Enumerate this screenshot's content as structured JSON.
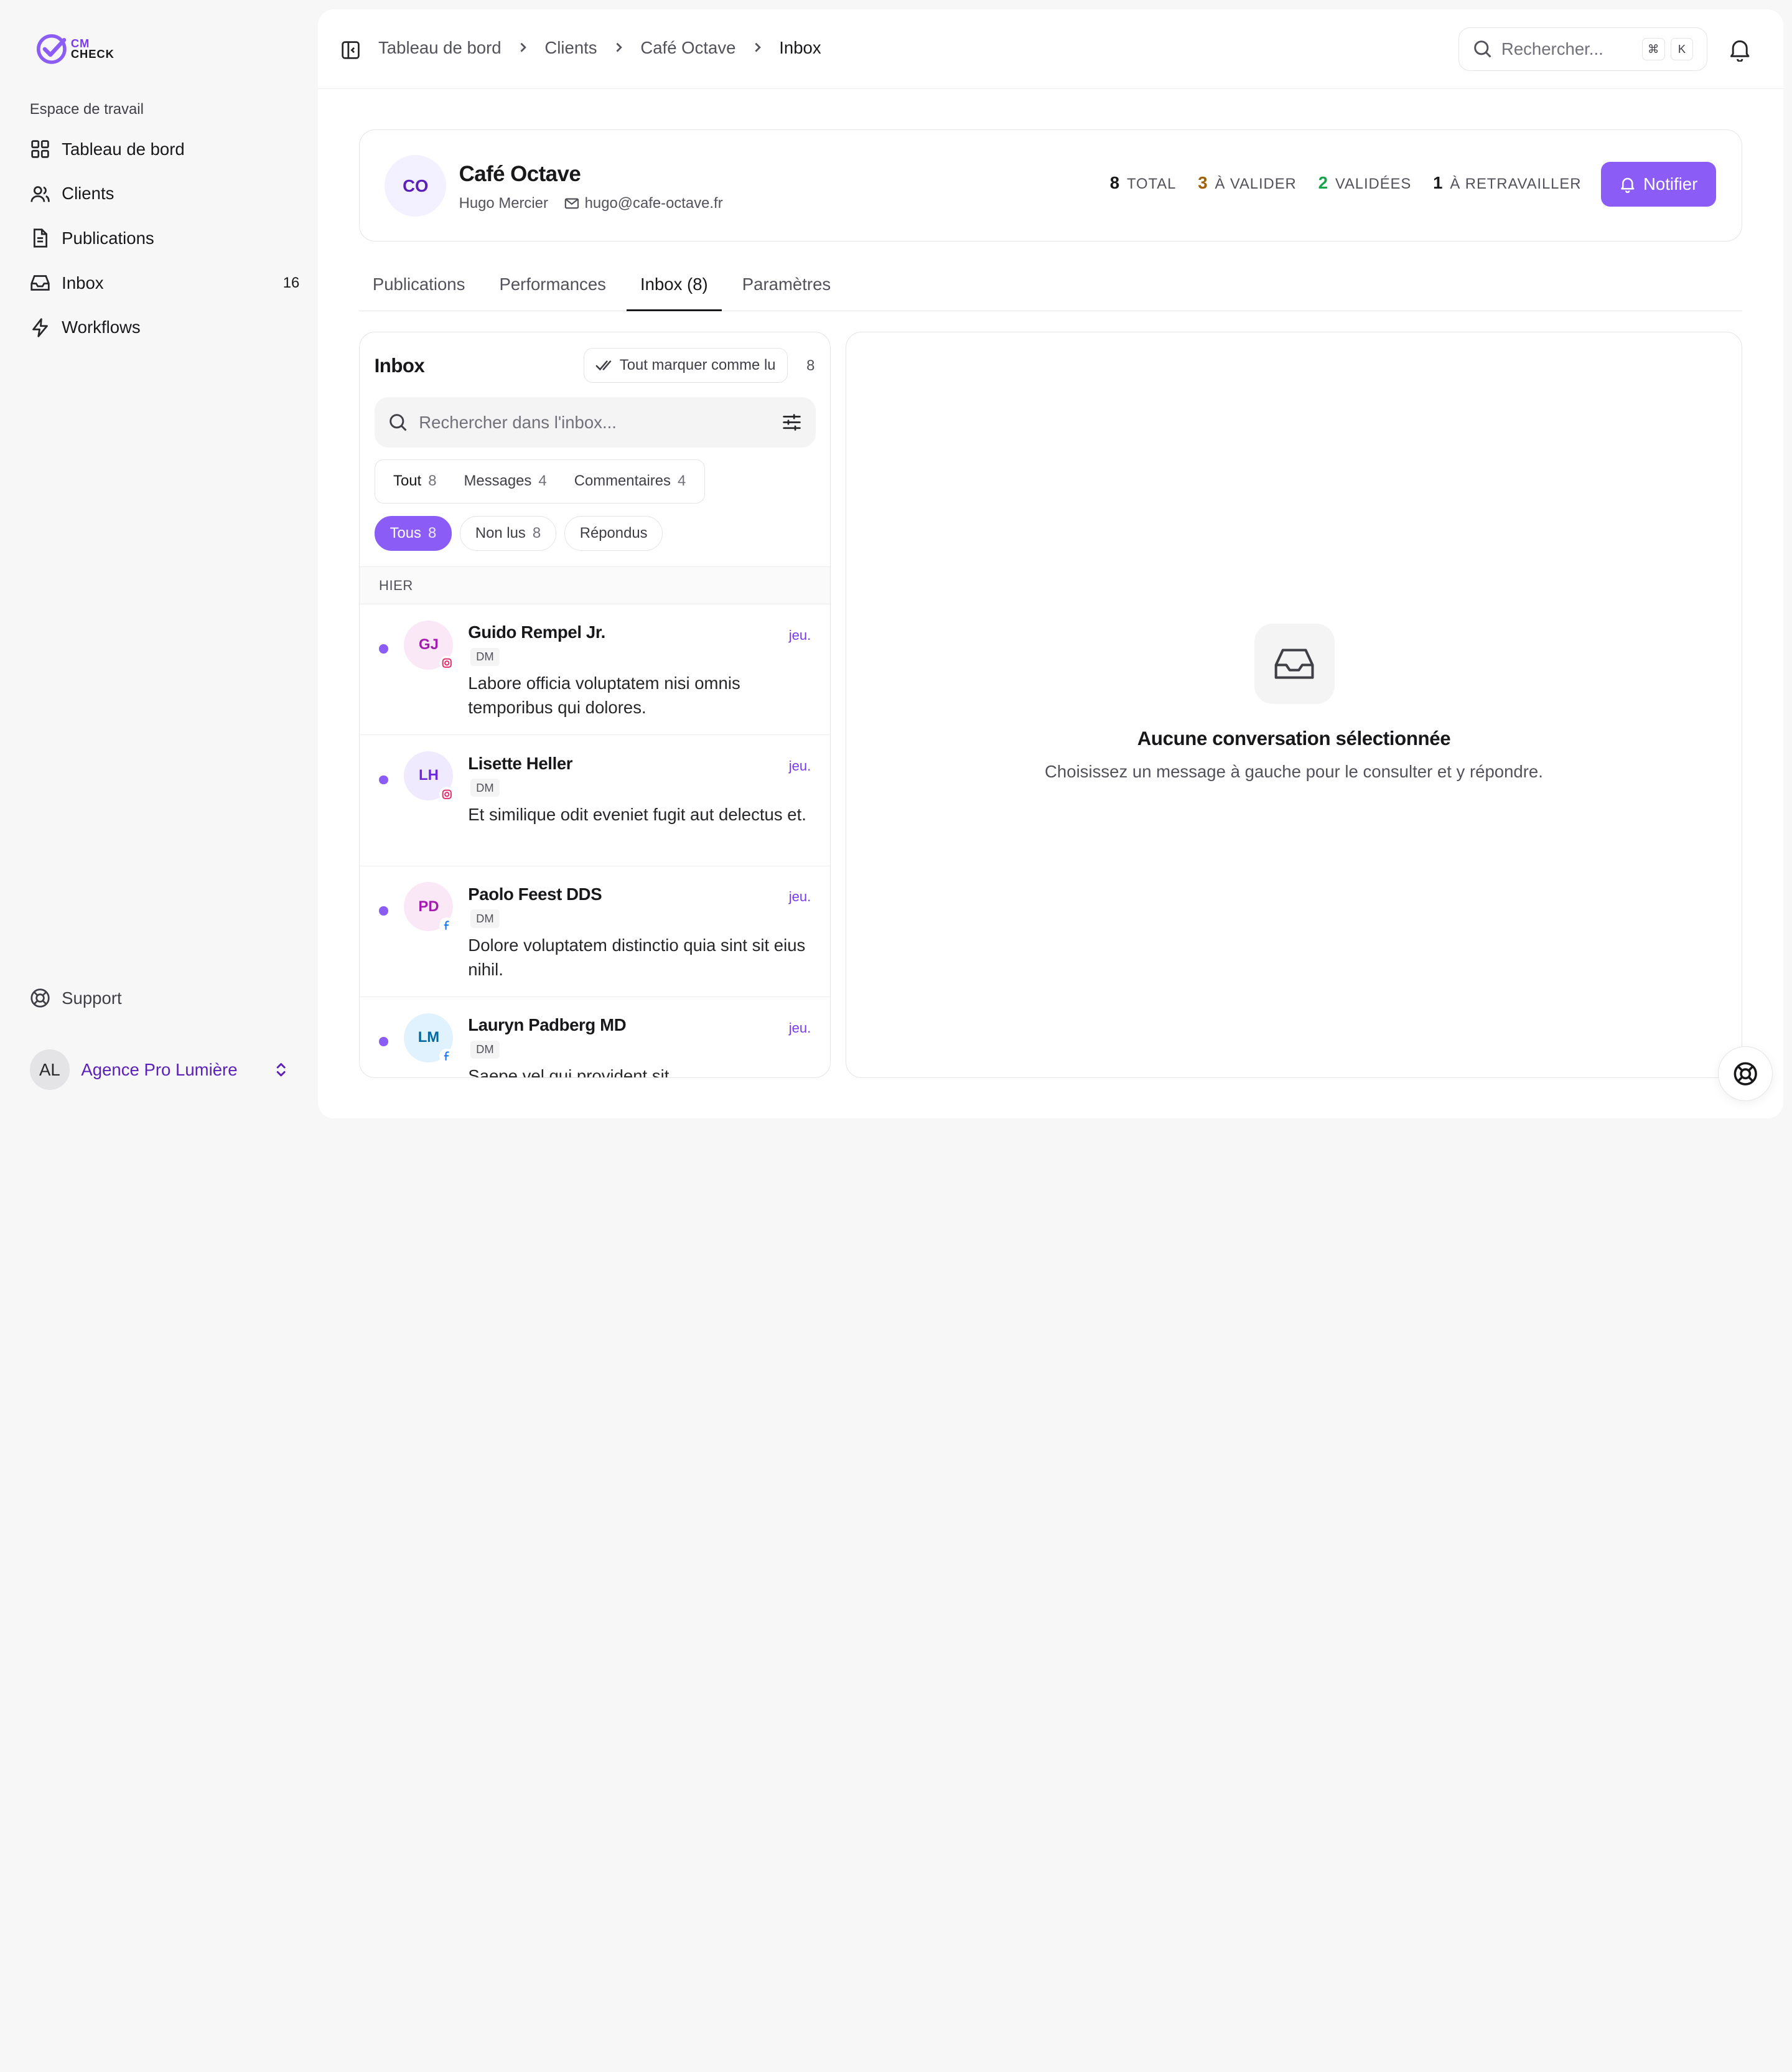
{
  "brand": {
    "line1": "CM",
    "line2": "CHECK",
    "accent": "#8b5cf6"
  },
  "sidebar": {
    "workspace_label": "Espace de travail",
    "items": [
      {
        "label": "Tableau de bord",
        "icon": "dashboard-icon"
      },
      {
        "label": "Clients",
        "icon": "users-icon"
      },
      {
        "label": "Publications",
        "icon": "file-icon"
      },
      {
        "label": "Inbox",
        "icon": "inbox-icon",
        "badge": "16"
      },
      {
        "label": "Workflows",
        "icon": "bolt-icon"
      }
    ],
    "support_label": "Support",
    "agency": {
      "initials": "AL",
      "name": "Agence Pro Lumière"
    }
  },
  "breadcrumb": [
    "Tableau de bord",
    "Clients",
    "Café Octave",
    "Inbox"
  ],
  "search": {
    "placeholder": "Rechercher...",
    "kbd1": "⌘",
    "kbd2": "K"
  },
  "client": {
    "initials": "CO",
    "name": "Café Octave",
    "contact": "Hugo Mercier",
    "email": "hugo@cafe-octave.fr",
    "stats": [
      {
        "value": "8",
        "label": "TOTAL"
      },
      {
        "value": "3",
        "label": "À VALIDER"
      },
      {
        "value": "2",
        "label": "VALIDÉES"
      },
      {
        "value": "1",
        "label": "À RETRAVAILLER"
      }
    ],
    "notify_label": "Notifier"
  },
  "tabs": [
    "Publications",
    "Performances",
    "Inbox (8)",
    "Paramètres"
  ],
  "inbox": {
    "title": "Inbox",
    "mark_read_label": "Tout marquer comme lu",
    "count": "8",
    "search_placeholder": "Rechercher dans l'inbox...",
    "segments": [
      {
        "label": "Tout",
        "count": "8"
      },
      {
        "label": "Messages",
        "count": "4"
      },
      {
        "label": "Commentaires",
        "count": "4"
      }
    ],
    "pills": [
      {
        "label": "Tous",
        "count": "8"
      },
      {
        "label": "Non lus",
        "count": "8"
      },
      {
        "label": "Répondus",
        "count": ""
      }
    ],
    "group_label": "HIER",
    "conversations": [
      {
        "initials": "GJ",
        "name": "Guido Rempel Jr.",
        "tag": "DM",
        "text": "Labore officia voluptatem nisi omnis temporibus qui dolores.",
        "when": "jeu.",
        "network": "instagram",
        "bg": "#fbe8f6",
        "fg": "#a21caf"
      },
      {
        "initials": "LH",
        "name": "Lisette Heller",
        "tag": "DM",
        "text": "Et similique odit eveniet fugit aut delectus et.",
        "when": "jeu.",
        "network": "instagram",
        "bg": "#efeafd",
        "fg": "#6d28d9"
      },
      {
        "initials": "PD",
        "name": "Paolo Feest DDS",
        "tag": "DM",
        "text": "Dolore voluptatem distinctio quia sint sit eius nihil.",
        "when": "jeu.",
        "network": "facebook",
        "bg": "#fbe8f6",
        "fg": "#a21caf"
      },
      {
        "initials": "LM",
        "name": "Lauryn Padberg MD",
        "tag": "DM",
        "text": "Saepe vel qui provident sit",
        "when": "jeu.",
        "network": "facebook",
        "bg": "#e0f2fe",
        "fg": "#0369a1"
      }
    ]
  },
  "detail": {
    "empty_title": "Aucune conversation sélectionnée",
    "empty_sub": "Choisissez un message à gauche pour le consulter et y répondre."
  }
}
